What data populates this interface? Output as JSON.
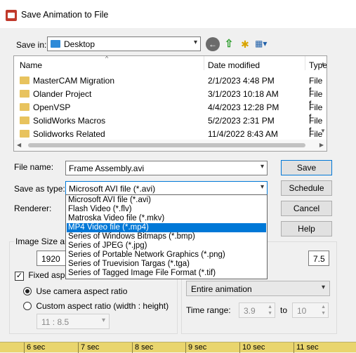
{
  "window": {
    "title": "Save Animation to File",
    "icon": "solidworks-app-icon"
  },
  "save_in": {
    "label": "Save in:",
    "value": "Desktop",
    "toolbar_icons": [
      "back-icon",
      "up-folder-icon",
      "new-folder-icon",
      "view-menu-icon"
    ]
  },
  "file_list": {
    "columns": [
      "Name",
      "Date modified",
      "Type"
    ],
    "rows": [
      {
        "name": "MasterCAM Migration",
        "date": "2/1/2023 4:48 PM",
        "type": "File f"
      },
      {
        "name": "Olander Project",
        "date": "3/1/2023 10:18 AM",
        "type": "File f"
      },
      {
        "name": "OpenVSP",
        "date": "4/4/2023 12:28 PM",
        "type": "File f"
      },
      {
        "name": "SolidWorks Macros",
        "date": "5/2/2023 2:31 PM",
        "type": "File f"
      },
      {
        "name": "Solidworks Related",
        "date": "11/4/2022 8:43 AM",
        "type": "File f"
      }
    ]
  },
  "file_name": {
    "label": "File name:",
    "value": "Frame Assembly.avi"
  },
  "save_as_type": {
    "label": "Save as type:",
    "value": "Microsoft AVI file (*.avi)",
    "options": [
      "Microsoft AVI file (*.avi)",
      "Flash Video (*.flv)",
      "Matroska Video file (*.mkv)",
      "MP4 Video file (*.mp4)",
      "Series of Windows Bitmaps (*.bmp)",
      "Series of JPEG (*.jpg)",
      "Series of Portable Network Graphics (*.png)",
      "Series of Truevision Targas (*.tga)",
      "Series of Tagged Image File Format (*.tif)"
    ],
    "highlighted_index": 3
  },
  "renderer": {
    "label": "Renderer:"
  },
  "buttons": {
    "save": "Save",
    "schedule": "Schedule",
    "cancel": "Cancel",
    "help": "Help"
  },
  "image_size": {
    "label": "Image Size and",
    "width_value": "1920",
    "fixed_aspect_label": "Fixed aspec",
    "fixed_aspect_checked": true,
    "use_camera_label": "Use camera aspect ratio",
    "custom_label": "Custom aspect ratio (width : height)",
    "custom_value": "11 : 8.5"
  },
  "frames": {
    "value": "7.5",
    "range_select": "Entire animation",
    "time_range_label": "Time range:",
    "time_from": "3.9",
    "to_label": "to",
    "time_to": "10"
  },
  "timeline": {
    "ticks": [
      "6 sec",
      "7 sec",
      "8 sec",
      "9 sec",
      "10 sec",
      "11 sec"
    ]
  },
  "colors": {
    "accent": "#0078d7",
    "timeline": "#e9d56e"
  }
}
